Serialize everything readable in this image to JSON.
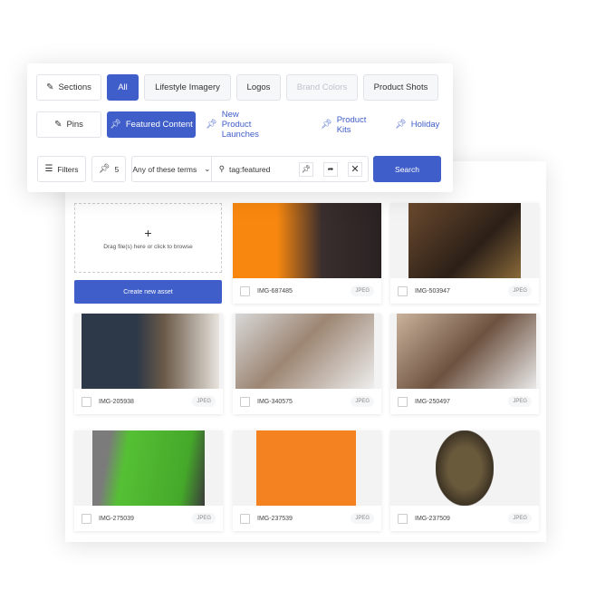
{
  "filters": {
    "sections_label": "Sections",
    "section_tabs": [
      {
        "label": "All",
        "state": "active"
      },
      {
        "label": "Lifestyle Imagery",
        "state": "default"
      },
      {
        "label": "Logos",
        "state": "default"
      },
      {
        "label": "Brand Colors",
        "state": "disabled"
      },
      {
        "label": "Product Shots",
        "state": "default"
      }
    ],
    "pins_label": "Pins",
    "pin_tabs": [
      {
        "label": "Featured Content",
        "state": "active"
      },
      {
        "label": "New Product Launches"
      },
      {
        "label": "Product Kits"
      },
      {
        "label": "Holiday"
      }
    ],
    "filters_label": "Filters",
    "pin_count": "5",
    "match_mode": "Any of these terms",
    "query": "tag:featured",
    "search_label": "Search",
    "accent": "#3f5ec9"
  },
  "upload": {
    "plus": "+",
    "text": "Drag file(s) here or click to browse",
    "create_label": "Create new asset"
  },
  "assets": [
    {
      "name": "IMG-687485",
      "type": "JPEG"
    },
    {
      "name": "IMG-503947",
      "type": "JPEG"
    },
    {
      "name": "IMG-205938",
      "type": "JPEG"
    },
    {
      "name": "IMG-340575",
      "type": "JPEG"
    },
    {
      "name": "IMG-250497",
      "type": "JPEG"
    },
    {
      "name": "IMG-275039",
      "type": "JPEG"
    },
    {
      "name": "IMG-237539",
      "type": "JPEG"
    },
    {
      "name": "IMG-237509",
      "type": "JPEG"
    }
  ]
}
